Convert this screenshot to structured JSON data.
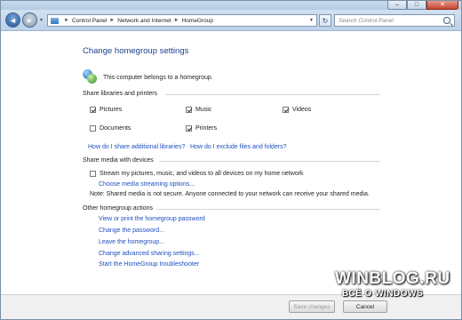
{
  "titlebar": {
    "minimize": "–",
    "maximize": "□",
    "close": "✕"
  },
  "nav": {
    "back_glyph": "◄",
    "forward_glyph": "►",
    "breadcrumbs": [
      "Control Panel",
      "Network and Internet",
      "HomeGroup"
    ],
    "separator": "►",
    "refresh_glyph": "↻"
  },
  "search": {
    "placeholder": "Search Control Panel"
  },
  "page": {
    "title": "Change homegroup settings",
    "belongs": "This computer belongs to a homegroup."
  },
  "share_libraries": {
    "heading": "Share libraries and printers",
    "items": [
      {
        "label": "Pictures",
        "checked": true
      },
      {
        "label": "Music",
        "checked": true
      },
      {
        "label": "Videos",
        "checked": true
      },
      {
        "label": "Documents",
        "checked": false
      },
      {
        "label": "Printers",
        "checked": true
      }
    ],
    "link1": "How do I share additional libraries?",
    "link2": "How do I exclude files and folders?"
  },
  "share_media": {
    "heading": "Share media with devices",
    "stream_label": "Stream my pictures, music, and videos to all devices on my home network",
    "stream_checked": false,
    "options_link": "Choose media streaming options...",
    "note": "Note: Shared media is not secure. Anyone connected to your network can receive your shared media."
  },
  "other_actions": {
    "heading": "Other homegroup actions",
    "links": [
      "View or print the homegroup password",
      "Change the password...",
      "Leave the homegroup...",
      "Change advanced sharing settings...",
      "Start the HomeGroup troubleshooter"
    ]
  },
  "footer": {
    "save": "Save changes",
    "cancel": "Cancel"
  },
  "watermark": {
    "line1": "WINBLOG.RU",
    "line2": "ВСЁ О WINDOWS"
  }
}
